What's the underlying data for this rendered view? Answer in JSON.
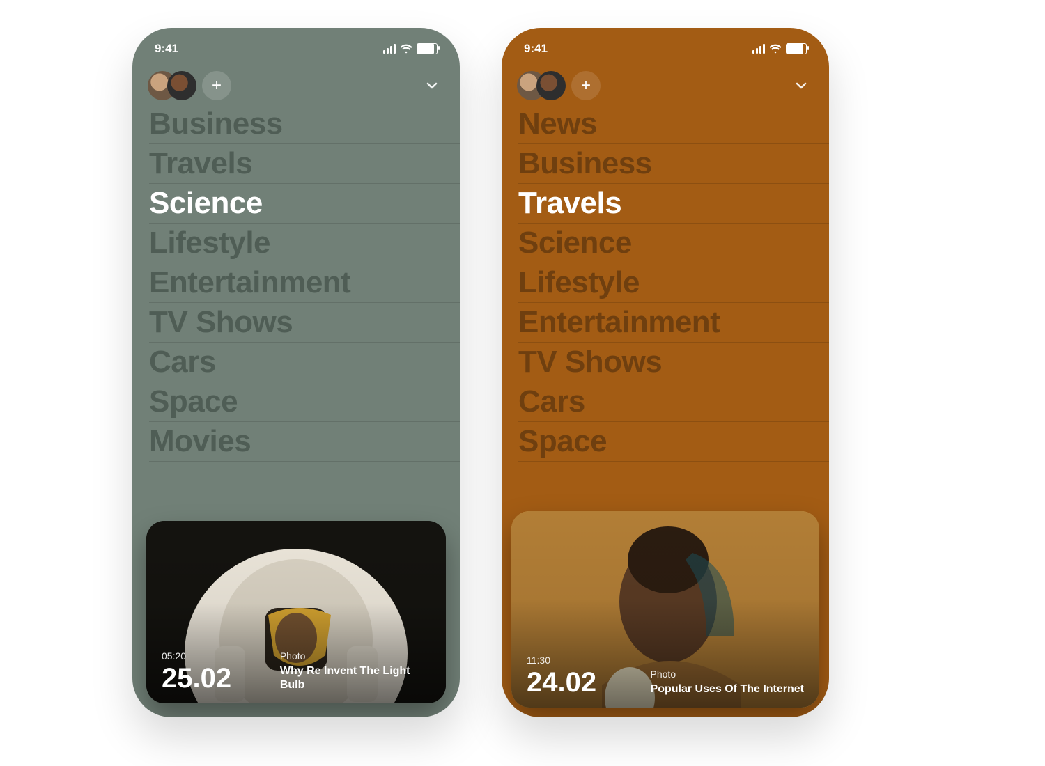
{
  "status": {
    "time": "9:41"
  },
  "plus": "+",
  "phones": [
    {
      "bg": "#718077",
      "categories": [
        "Business",
        "Travels",
        "Science",
        "Lifestyle",
        "Entertainment",
        "TV Shows",
        "Cars",
        "Space",
        "Movies"
      ],
      "activeIndex": 2,
      "card": {
        "time": "05:20",
        "date": "25.02",
        "kicker": "Photo",
        "title": "Why Re Invent The Light Bulb"
      }
    },
    {
      "bg": "#a35c14",
      "categories": [
        "News",
        "Business",
        "Travels",
        "Science",
        "Lifestyle",
        "Entertainment",
        "TV Shows",
        "Cars",
        "Space"
      ],
      "activeIndex": 2,
      "card": {
        "time": "11:30",
        "date": "24.02",
        "kicker": "Photo",
        "title": "Popular Uses Of The Internet"
      }
    }
  ]
}
